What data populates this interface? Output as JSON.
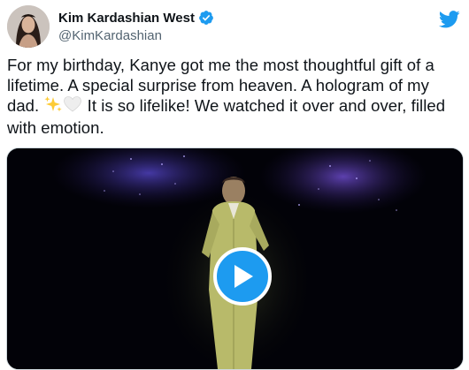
{
  "author": {
    "display_name": "Kim Kardashian West",
    "handle": "@KimKardashian",
    "verified": true
  },
  "tweet": {
    "text_part1": "For my birthday, Kanye got me the most thoughtful gift of a lifetime. A special surprise from heaven. A hologram of my dad.",
    "text_part2": "It is so lifelike! We watched it over and over, filled with emotion.",
    "emojis": [
      "sparkles-emoji",
      "white-heart-emoji"
    ]
  },
  "icons": {
    "brand": "twitter-bird-icon",
    "verified": "verified-badge-icon",
    "play": "play-icon"
  },
  "colors": {
    "accent": "#1d9bf0",
    "text": "#0f1419",
    "secondary_text": "#536471"
  }
}
